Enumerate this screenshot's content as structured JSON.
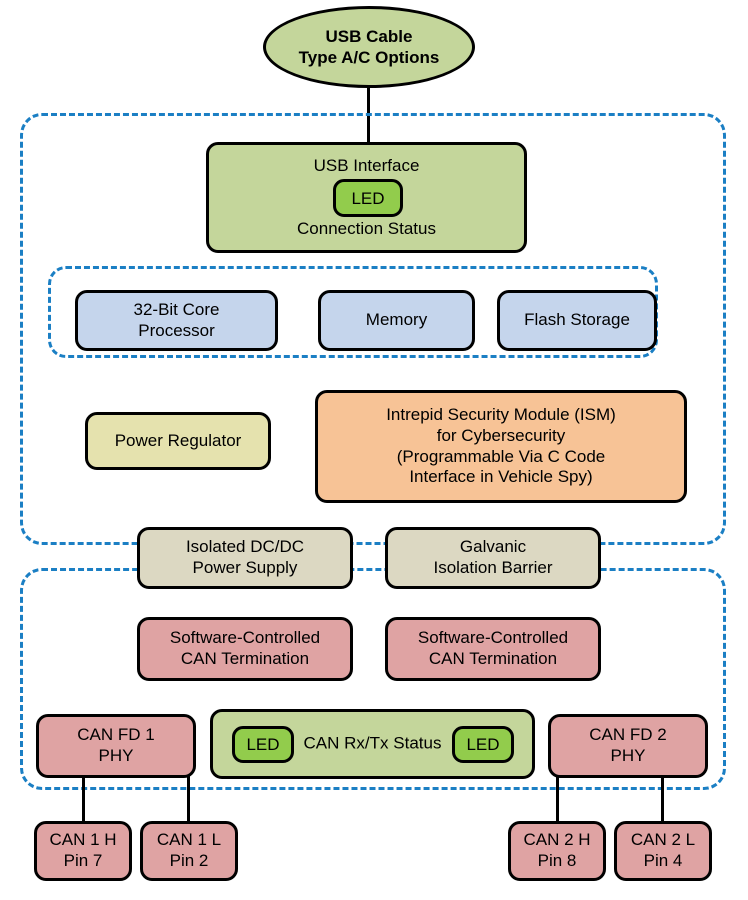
{
  "diagram": {
    "title_node": {
      "line1": "USB Cable",
      "line2": "Type A/C Options"
    },
    "usb_interface": {
      "title": "USB Interface",
      "led_label": "LED",
      "subtitle": "Connection Status"
    },
    "core_group": [
      {
        "line1": "32-Bit Core",
        "line2": "Processor"
      },
      {
        "line1": "Memory",
        "line2": ""
      },
      {
        "line1": "Flash Storage",
        "line2": ""
      }
    ],
    "power_regulator": {
      "line1": "Power Regulator"
    },
    "security_module": {
      "line1": "Intrepid Security Module (ISM)",
      "line2": "for Cybersecurity",
      "line3": "(Programmable Via C Code",
      "line4": "Interface in Vehicle Spy)"
    },
    "isolation": [
      {
        "line1": "Isolated DC/DC",
        "line2": "Power Supply"
      },
      {
        "line1": "Galvanic",
        "line2": "Isolation Barrier"
      }
    ],
    "termination": [
      {
        "line1": "Software-Controlled",
        "line2": "CAN Termination"
      },
      {
        "line1": "Software-Controlled",
        "line2": "CAN Termination"
      }
    ],
    "phys": [
      {
        "line1": "CAN FD 1",
        "line2": "PHY"
      },
      {
        "line1": "CAN FD 2",
        "line2": "PHY"
      }
    ],
    "can_status": {
      "line1": "CAN",
      "line2": "Rx/Tx Status",
      "led_left": "LED",
      "led_right": "LED"
    },
    "pins": [
      {
        "line1": "CAN 1 H",
        "line2": "Pin 7"
      },
      {
        "line1": "CAN 1 L",
        "line2": "Pin 2"
      },
      {
        "line1": "CAN 2 H",
        "line2": "Pin 8"
      },
      {
        "line1": "CAN 2 L",
        "line2": "Pin 4"
      }
    ],
    "colors": {
      "group_border": "#1b7fc4",
      "node_border": "#000000",
      "green": "#c4d69b",
      "led_green": "#92cc4c",
      "blue": "#c5d5ec",
      "yellow": "#e5e2ae",
      "orange": "#f7c396",
      "beige": "#dcd8c2",
      "pink": "#dfa3a3",
      "background": "#ffffff"
    }
  }
}
